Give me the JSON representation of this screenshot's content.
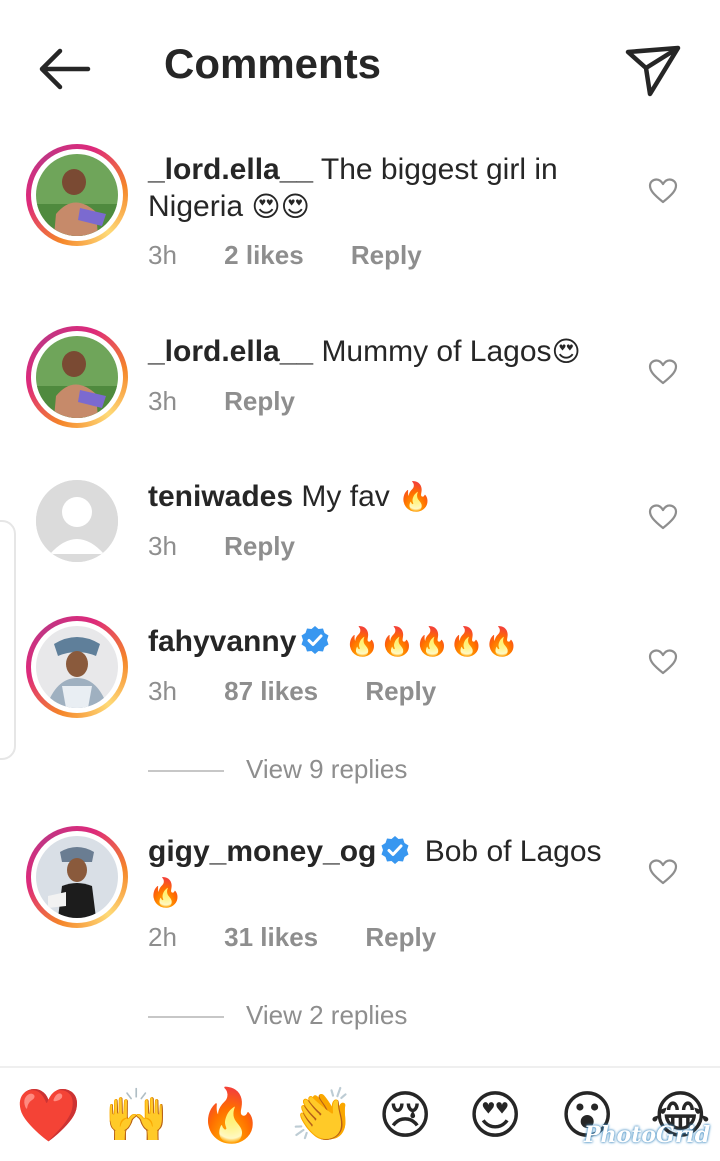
{
  "header": {
    "title": "Comments"
  },
  "comments": [
    {
      "username": "_lord.ella__",
      "text": "The biggest girl in Nigeria",
      "emoji": "😍😍",
      "time": "3h",
      "likes": "2 likes",
      "reply": "Reply"
    },
    {
      "username": "_lord.ella__",
      "text": "Mummy of Lagos",
      "emoji": "😍",
      "time": "3h",
      "reply": "Reply"
    },
    {
      "username": "teniwades",
      "text": "My fav",
      "emoji": "🔥",
      "time": "3h",
      "reply": "Reply"
    },
    {
      "username": "fahyvanny",
      "emoji": "🔥🔥🔥🔥🔥",
      "time": "3h",
      "likes": "87 likes",
      "reply": "Reply",
      "view_replies": "View 9 replies"
    },
    {
      "username": "gigy_money_og",
      "text": "Bob of Lagos",
      "emoji": "🔥",
      "time": "2h",
      "likes": "31 likes",
      "reply": "Reply",
      "view_replies": "View 2 replies"
    }
  ],
  "emoji_bar": [
    "❤️",
    "🙌",
    "🔥",
    "👏",
    "😢",
    "😍",
    "😮",
    "😂"
  ],
  "watermark": "PhotoGrid",
  "colors": {
    "verified": "#3897f0",
    "ring_start": "#f58529",
    "ring_end": "#dd2a7b",
    "muted": "#8e8e8e"
  },
  "icons": {
    "back": "arrow-left-icon",
    "send": "paper-plane-icon",
    "like": "heart-outline-icon",
    "verified": "verified-badge-icon"
  }
}
